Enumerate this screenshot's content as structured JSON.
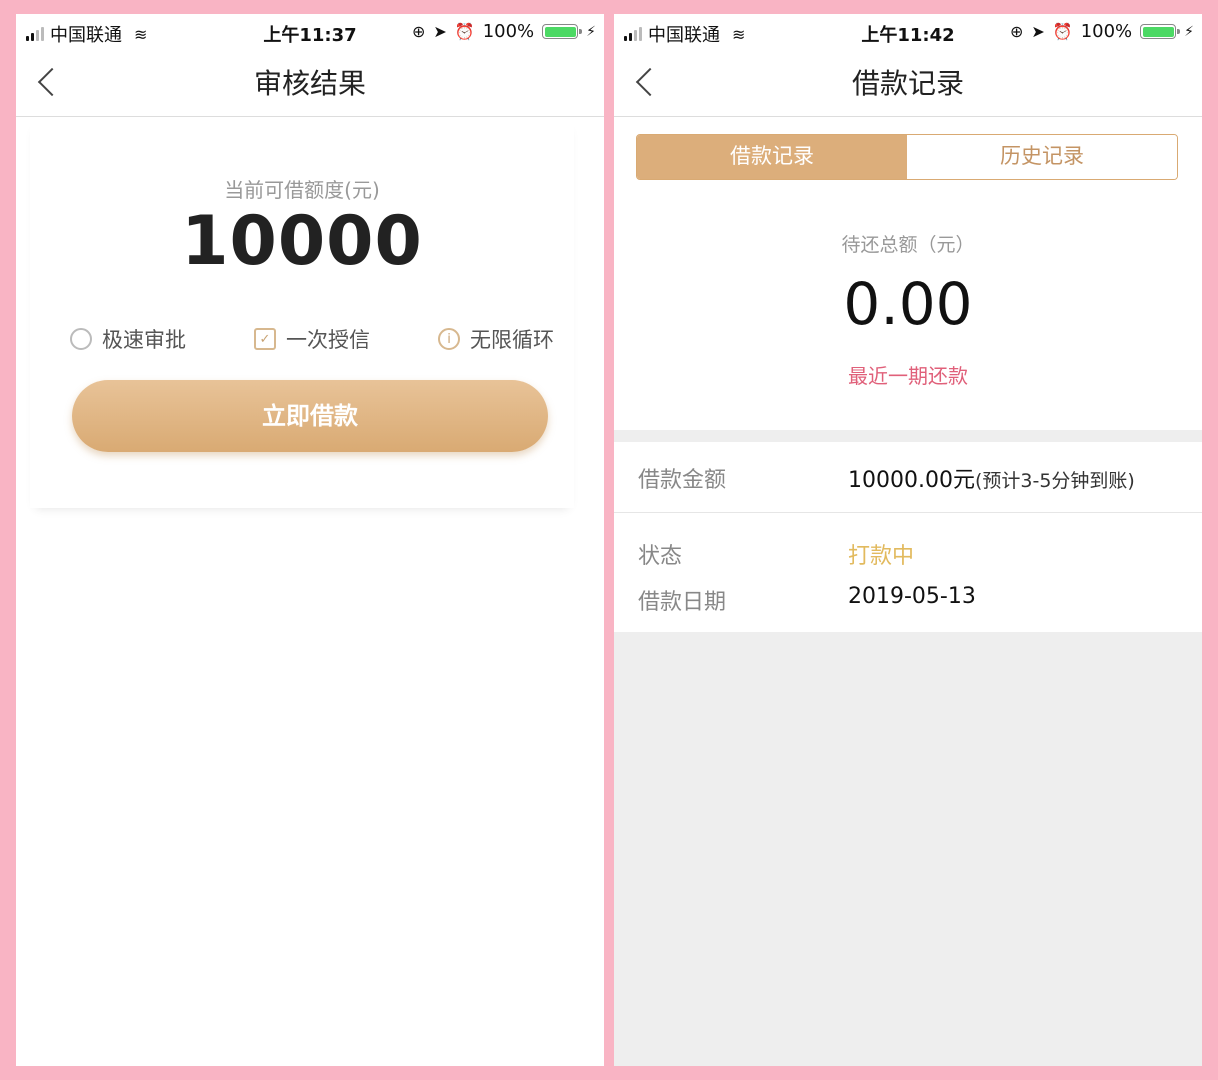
{
  "left_phone": {
    "status": {
      "carrier": "中国联通",
      "time": "上午11:37",
      "battery": "100%"
    },
    "nav": {
      "title": "审核结果"
    },
    "credit": {
      "label": "当前可借额度(元)",
      "amount": "10000",
      "features": [
        {
          "icon": "search-icon",
          "label": "极速审批"
        },
        {
          "icon": "check-icon",
          "label": "一次授信"
        },
        {
          "icon": "info-icon",
          "label": "无限循环"
        }
      ],
      "button": "立即借款"
    }
  },
  "right_phone": {
    "status": {
      "carrier": "中国联通",
      "time": "上午11:42",
      "battery": "100%"
    },
    "nav": {
      "title": "借款记录"
    },
    "tabs": [
      {
        "label": "借款记录",
        "active": true
      },
      {
        "label": "历史记录",
        "active": false
      }
    ],
    "repay": {
      "label": "待还总额（元）",
      "amount": "0.00",
      "link": "最近一期还款"
    },
    "loan": {
      "amount_label": "借款金额",
      "amount_value": "10000.00元",
      "amount_note": "(预计3-5分钟到账)",
      "status_label": "状态",
      "status_value": "打款中",
      "date_label": "借款日期",
      "date_value": "2019-05-13"
    }
  },
  "colors": {
    "accent": "#d9aa73",
    "status": "#e2ba5e",
    "link": "#e0607a",
    "frame": "#f9b4c4"
  }
}
